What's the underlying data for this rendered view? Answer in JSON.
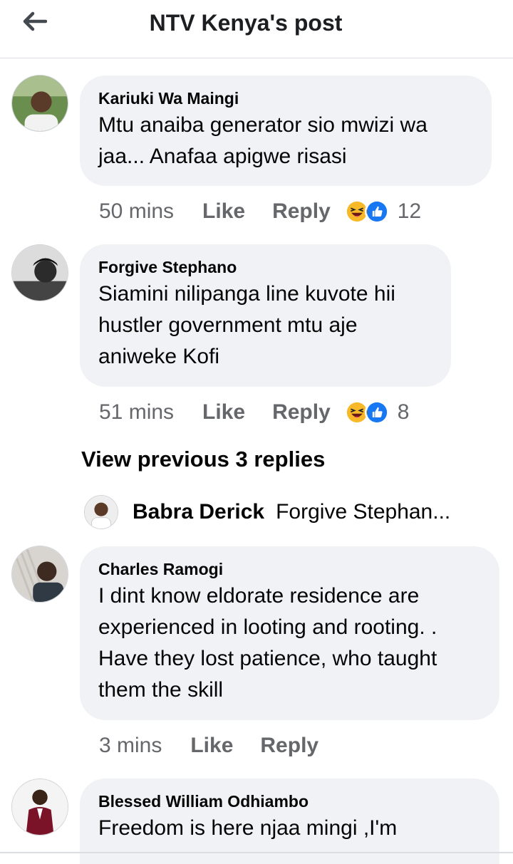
{
  "header": {
    "title": "NTV Kenya's post",
    "back_icon": "back-arrow-icon"
  },
  "comments": [
    {
      "author": "Kariuki Wa Maingi",
      "text": "Mtu anaiba generator sio mwizi wa jaa... Anafaa apigwe risasi",
      "time": "50 mins",
      "like_label": "Like",
      "reply_label": "Reply",
      "reactions": [
        "haha-icon",
        "like-icon"
      ],
      "reaction_count": "12"
    },
    {
      "author": "Forgive Stephano",
      "text": "Siamini nilipanga line kuvote hii hustler government mtu aje aniweke Kofi",
      "time": "51 mins",
      "like_label": "Like",
      "reply_label": "Reply",
      "reactions": [
        "haha-icon",
        "like-icon"
      ],
      "reaction_count": "8"
    },
    {
      "author": "Charles Ramogi",
      "text": "I dint know eldorate residence are experienced in looting and rooting. . Have they lost patience, who taught them the skill",
      "time": "3 mins",
      "like_label": "Like",
      "reply_label": "Reply"
    },
    {
      "author": "Blessed William Odhiambo",
      "text": "Freedom is here njaa mingi ,I'm"
    }
  ],
  "view_previous": "View previous 3 replies",
  "reply_preview": {
    "author": "Babra Derick",
    "snippet": "Forgive Stephan..."
  },
  "colors": {
    "bubble": "#f0f2f5",
    "secondary_text": "#65676b",
    "like_blue": "#1877f2",
    "haha_yellow": "#f7b928"
  }
}
